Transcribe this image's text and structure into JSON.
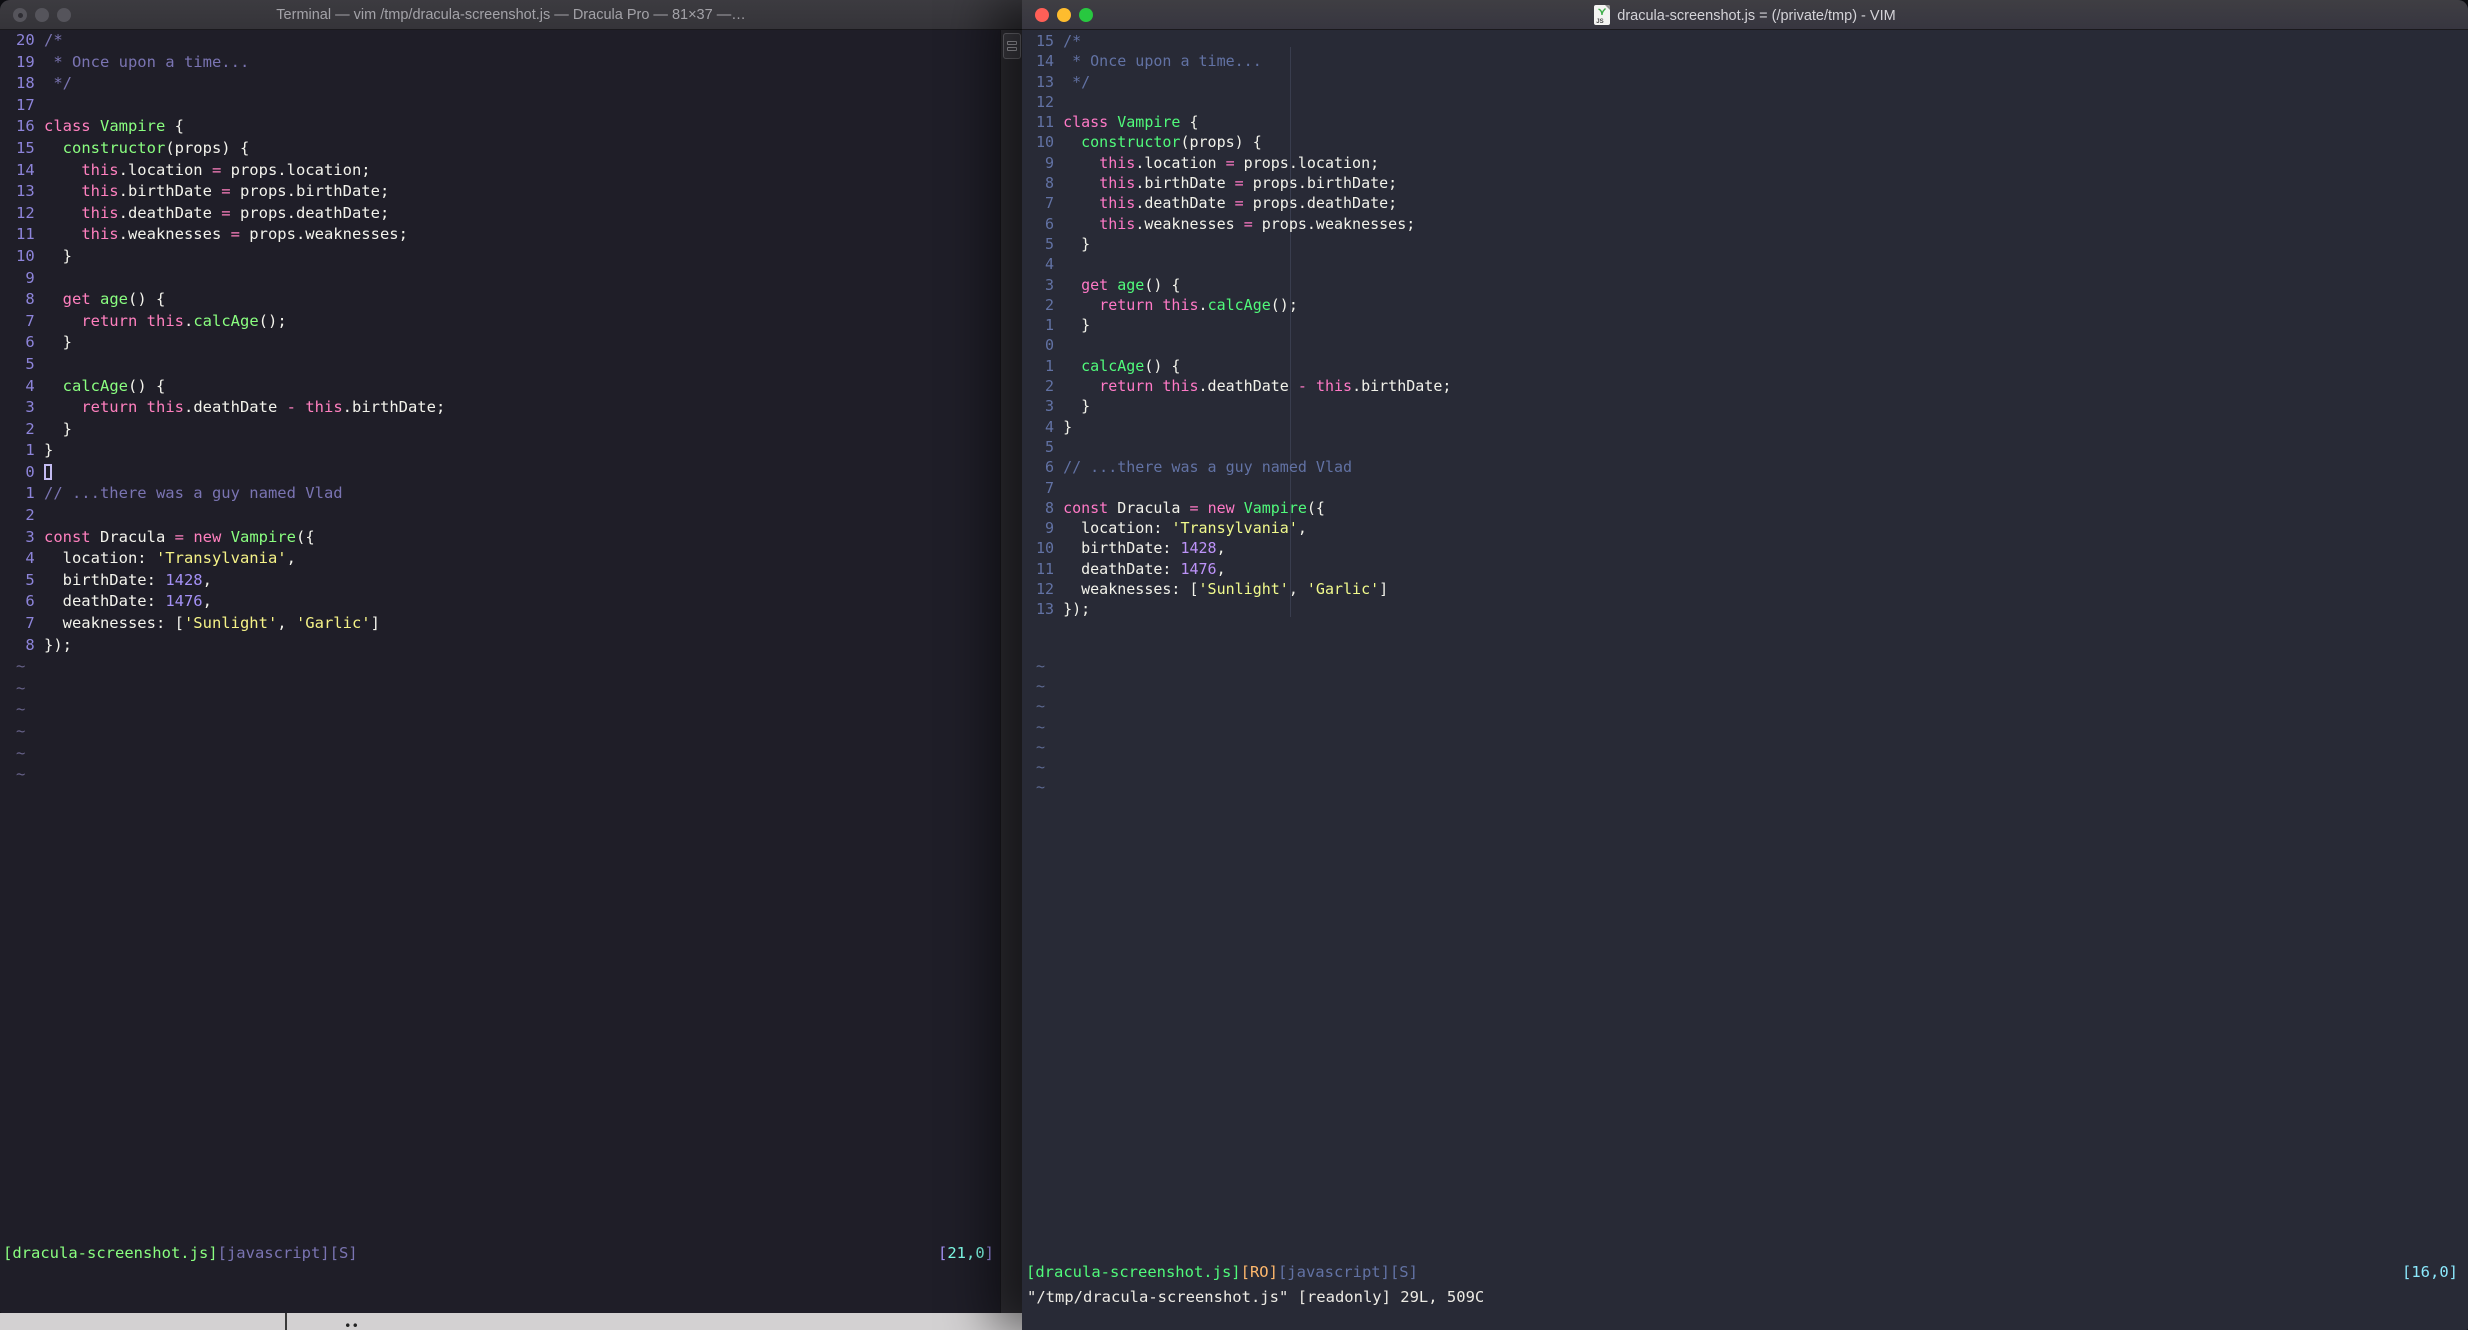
{
  "left_window": {
    "title": "Terminal — vim /tmp/dracula-screenshot.js — Dracula Pro — 81×37 —…",
    "palette": {
      "f": "#f3f3ec",
      "p": "#ff80bf",
      "g": "#8aff80",
      "y": "#f5f287",
      "u": "#a491f5",
      "c": "#7a74b2",
      "n": "#8d84da",
      "cy": "#80ffea"
    },
    "line_number_color": "#8d84da",
    "tilde_color": "#67628a",
    "tilde": "~",
    "tilde_count": 6,
    "lines": [
      {
        "n": "20",
        "s": [
          [
            "c",
            "/*"
          ]
        ]
      },
      {
        "n": "19",
        "s": [
          [
            "c",
            " * Once upon a time..."
          ]
        ]
      },
      {
        "n": "18",
        "s": [
          [
            "c",
            " */"
          ]
        ]
      },
      {
        "n": "17",
        "s": []
      },
      {
        "n": "16",
        "s": [
          [
            "p",
            "class"
          ],
          [
            "f",
            " "
          ],
          [
            "g",
            "Vampire"
          ],
          [
            "f",
            " {"
          ]
        ]
      },
      {
        "n": "15",
        "s": [
          [
            "f",
            "  "
          ],
          [
            "g",
            "constructor"
          ],
          [
            "f",
            "(props) {"
          ]
        ]
      },
      {
        "n": "14",
        "s": [
          [
            "f",
            "    "
          ],
          [
            "p",
            "this"
          ],
          [
            "f",
            ".location "
          ],
          [
            "p",
            "="
          ],
          [
            "f",
            " props.location;"
          ]
        ]
      },
      {
        "n": "13",
        "s": [
          [
            "f",
            "    "
          ],
          [
            "p",
            "this"
          ],
          [
            "f",
            ".birthDate "
          ],
          [
            "p",
            "="
          ],
          [
            "f",
            " props.birthDate;"
          ]
        ]
      },
      {
        "n": "12",
        "s": [
          [
            "f",
            "    "
          ],
          [
            "p",
            "this"
          ],
          [
            "f",
            ".deathDate "
          ],
          [
            "p",
            "="
          ],
          [
            "f",
            " props.deathDate;"
          ]
        ]
      },
      {
        "n": "11",
        "s": [
          [
            "f",
            "    "
          ],
          [
            "p",
            "this"
          ],
          [
            "f",
            ".weaknesses "
          ],
          [
            "p",
            "="
          ],
          [
            "f",
            " props.weaknesses;"
          ]
        ]
      },
      {
        "n": "10",
        "s": [
          [
            "f",
            "  }"
          ]
        ]
      },
      {
        "n": "9",
        "s": []
      },
      {
        "n": "8",
        "s": [
          [
            "f",
            "  "
          ],
          [
            "p",
            "get"
          ],
          [
            "f",
            " "
          ],
          [
            "g",
            "age"
          ],
          [
            "f",
            "() {"
          ]
        ]
      },
      {
        "n": "7",
        "s": [
          [
            "f",
            "    "
          ],
          [
            "p",
            "return"
          ],
          [
            "f",
            " "
          ],
          [
            "p",
            "this"
          ],
          [
            "f",
            "."
          ],
          [
            "g",
            "calcAge"
          ],
          [
            "f",
            "();"
          ]
        ]
      },
      {
        "n": "6",
        "s": [
          [
            "f",
            "  }"
          ]
        ]
      },
      {
        "n": "5",
        "s": []
      },
      {
        "n": "4",
        "s": [
          [
            "f",
            "  "
          ],
          [
            "g",
            "calcAge"
          ],
          [
            "f",
            "() {"
          ]
        ]
      },
      {
        "n": "3",
        "s": [
          [
            "f",
            "    "
          ],
          [
            "p",
            "return"
          ],
          [
            "f",
            " "
          ],
          [
            "p",
            "this"
          ],
          [
            "f",
            ".deathDate "
          ],
          [
            "p",
            "-"
          ],
          [
            "f",
            " "
          ],
          [
            "p",
            "this"
          ],
          [
            "f",
            ".birthDate;"
          ]
        ]
      },
      {
        "n": "2",
        "s": [
          [
            "f",
            "  }"
          ]
        ]
      },
      {
        "n": "1",
        "s": [
          [
            "f",
            "}"
          ]
        ]
      },
      {
        "n": "0",
        "s": [],
        "cursor": true
      },
      {
        "n": "1",
        "s": [
          [
            "c",
            "// ...there was a guy named Vlad"
          ]
        ]
      },
      {
        "n": "2",
        "s": []
      },
      {
        "n": "3",
        "s": [
          [
            "p",
            "const"
          ],
          [
            "f",
            " Dracula "
          ],
          [
            "p",
            "="
          ],
          [
            "f",
            " "
          ],
          [
            "p",
            "new"
          ],
          [
            "f",
            " "
          ],
          [
            "g",
            "Vampire"
          ],
          [
            "f",
            "({"
          ]
        ]
      },
      {
        "n": "4",
        "s": [
          [
            "f",
            "  location: "
          ],
          [
            "y",
            "'Transylvania'"
          ],
          [
            "f",
            ","
          ]
        ]
      },
      {
        "n": "5",
        "s": [
          [
            "f",
            "  birthDate: "
          ],
          [
            "u",
            "1428"
          ],
          [
            "f",
            ","
          ]
        ]
      },
      {
        "n": "6",
        "s": [
          [
            "f",
            "  deathDate: "
          ],
          [
            "u",
            "1476"
          ],
          [
            "f",
            ","
          ]
        ]
      },
      {
        "n": "7",
        "s": [
          [
            "f",
            "  weaknesses: ["
          ],
          [
            "y",
            "'Sunlight'"
          ],
          [
            "f",
            ", "
          ],
          [
            "y",
            "'Garlic'"
          ],
          [
            "f",
            "]"
          ]
        ]
      },
      {
        "n": "8",
        "s": [
          [
            "f",
            "});"
          ]
        ]
      }
    ],
    "status_left": [
      [
        "g",
        "[dracula-screenshot.js]"
      ],
      [
        "c",
        "[javascript][S]"
      ]
    ],
    "status_right": [
      [
        "u",
        "["
      ],
      [
        "cy",
        "21,0"
      ],
      [
        "u",
        "]"
      ]
    ]
  },
  "right_window": {
    "title": "dracula-screenshot.js = (/private/tmp) - VIM",
    "doc_icon_label": "JS",
    "traffic_lights": {
      "close": "#ff5f57",
      "minimize": "#febc2e",
      "zoom": "#28c840"
    },
    "palette": {
      "f": "#f2f2ea",
      "p": "#ff79c6",
      "g": "#50fa7b",
      "y": "#f1fa8c",
      "u": "#bd93f9",
      "c": "#6272a4",
      "n": "#6272a4",
      "cy": "#8be9fd",
      "o": "#ffb86c"
    },
    "line_number_color": "#6272a4",
    "tilde_color": "#5c6890",
    "tilde": "~",
    "tilde_count": 7,
    "lines": [
      {
        "n": "15",
        "s": [
          [
            "c",
            "/*"
          ]
        ]
      },
      {
        "n": "14",
        "s": [
          [
            "c",
            " * Once upon a time..."
          ]
        ]
      },
      {
        "n": "13",
        "s": [
          [
            "c",
            " */"
          ]
        ]
      },
      {
        "n": "12",
        "s": []
      },
      {
        "n": "11",
        "s": [
          [
            "p",
            "class"
          ],
          [
            "f",
            " "
          ],
          [
            "g",
            "Vampire"
          ],
          [
            "f",
            " {"
          ]
        ]
      },
      {
        "n": "10",
        "s": [
          [
            "f",
            "  "
          ],
          [
            "g",
            "constructor"
          ],
          [
            "f",
            "(props) {"
          ]
        ]
      },
      {
        "n": "9",
        "s": [
          [
            "f",
            "    "
          ],
          [
            "p",
            "this"
          ],
          [
            "f",
            ".location "
          ],
          [
            "p",
            "="
          ],
          [
            "f",
            " props.location;"
          ]
        ]
      },
      {
        "n": "8",
        "s": [
          [
            "f",
            "    "
          ],
          [
            "p",
            "this"
          ],
          [
            "f",
            ".birthDate "
          ],
          [
            "p",
            "="
          ],
          [
            "f",
            " props.birthDate;"
          ]
        ]
      },
      {
        "n": "7",
        "s": [
          [
            "f",
            "    "
          ],
          [
            "p",
            "this"
          ],
          [
            "f",
            ".deathDate "
          ],
          [
            "p",
            "="
          ],
          [
            "f",
            " props.deathDate;"
          ]
        ]
      },
      {
        "n": "6",
        "s": [
          [
            "f",
            "    "
          ],
          [
            "p",
            "this"
          ],
          [
            "f",
            ".weaknesses "
          ],
          [
            "p",
            "="
          ],
          [
            "f",
            " props.weaknesses;"
          ]
        ]
      },
      {
        "n": "5",
        "s": [
          [
            "f",
            "  }"
          ]
        ]
      },
      {
        "n": "4",
        "s": []
      },
      {
        "n": "3",
        "s": [
          [
            "f",
            "  "
          ],
          [
            "p",
            "get"
          ],
          [
            "f",
            " "
          ],
          [
            "g",
            "age"
          ],
          [
            "f",
            "() {"
          ]
        ]
      },
      {
        "n": "2",
        "s": [
          [
            "f",
            "    "
          ],
          [
            "p",
            "return"
          ],
          [
            "f",
            " "
          ],
          [
            "p",
            "this"
          ],
          [
            "f",
            "."
          ],
          [
            "g",
            "calcAge"
          ],
          [
            "f",
            "();"
          ]
        ]
      },
      {
        "n": "1",
        "s": [
          [
            "f",
            "  }"
          ]
        ]
      },
      {
        "n": "0",
        "s": []
      },
      {
        "n": "1",
        "s": [
          [
            "f",
            "  "
          ],
          [
            "g",
            "calcAge"
          ],
          [
            "f",
            "() {"
          ]
        ]
      },
      {
        "n": "2",
        "s": [
          [
            "f",
            "    "
          ],
          [
            "p",
            "return"
          ],
          [
            "f",
            " "
          ],
          [
            "p",
            "this"
          ],
          [
            "f",
            ".deathDate "
          ],
          [
            "p",
            "-"
          ],
          [
            "f",
            " "
          ],
          [
            "p",
            "this"
          ],
          [
            "f",
            ".birthDate;"
          ]
        ]
      },
      {
        "n": "3",
        "s": [
          [
            "f",
            "  }"
          ]
        ]
      },
      {
        "n": "4",
        "s": [
          [
            "f",
            "}"
          ]
        ]
      },
      {
        "n": "5",
        "s": []
      },
      {
        "n": "6",
        "s": [
          [
            "c",
            "// ...there was a guy named Vlad"
          ]
        ]
      },
      {
        "n": "7",
        "s": []
      },
      {
        "n": "8",
        "s": [
          [
            "p",
            "const"
          ],
          [
            "f",
            " Dracula "
          ],
          [
            "p",
            "="
          ],
          [
            "f",
            " "
          ],
          [
            "p",
            "new"
          ],
          [
            "f",
            " "
          ],
          [
            "g",
            "Vampire"
          ],
          [
            "f",
            "({"
          ]
        ]
      },
      {
        "n": "9",
        "s": [
          [
            "f",
            "  location: "
          ],
          [
            "y",
            "'Transylvania'"
          ],
          [
            "f",
            ","
          ]
        ]
      },
      {
        "n": "10",
        "s": [
          [
            "f",
            "  birthDate: "
          ],
          [
            "u",
            "1428"
          ],
          [
            "f",
            ","
          ]
        ]
      },
      {
        "n": "11",
        "s": [
          [
            "f",
            "  deathDate: "
          ],
          [
            "u",
            "1476"
          ],
          [
            "f",
            ","
          ]
        ]
      },
      {
        "n": "12",
        "s": [
          [
            "f",
            "  weaknesses: ["
          ],
          [
            "y",
            "'Sunlight'"
          ],
          [
            "f",
            ", "
          ],
          [
            "y",
            "'Garlic'"
          ],
          [
            "f",
            "]"
          ]
        ]
      },
      {
        "n": "13",
        "s": [
          [
            "f",
            "});"
          ]
        ]
      }
    ],
    "status_left": [
      [
        "g",
        "[dracula-screenshot.js]"
      ],
      [
        "o",
        "[RO]"
      ],
      [
        "c",
        "[javascript][S]"
      ]
    ],
    "status_right": [
      [
        "cy",
        "[16,0]"
      ]
    ],
    "cmdline": "\"/tmp/dracula-screenshot.js\" [readonly] 29L, 509C"
  }
}
